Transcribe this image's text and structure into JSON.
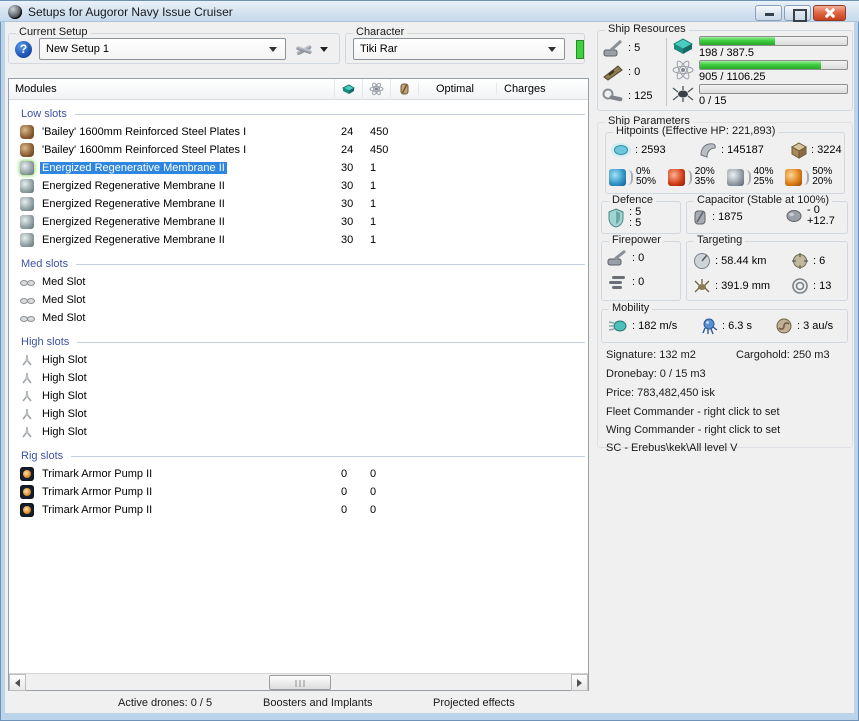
{
  "window": {
    "title": "Setups for Augoror Navy Issue Cruiser"
  },
  "icons": {
    "help": "?"
  },
  "colors": {
    "selection": "#2f86e0",
    "accent_green": "#3dd13d",
    "section_header_blue": "#3f51a0",
    "progress_green": "#3fcf3f",
    "em": "#2e90c2",
    "thermal": "#cf3a14",
    "kinetic": "#8e98a2",
    "explosive": "#d97a14",
    "close_button_red": "#c8401f"
  },
  "setup_bar": {
    "current_setup_label": "Current Setup",
    "current_setup_value": "New Setup 1",
    "character_label": "Character",
    "character_value": "Tiki Rar"
  },
  "modules_panel": {
    "title": "Modules",
    "optimal_label": "Optimal",
    "charges_label": "Charges",
    "sections": [
      {
        "title": "Low slots",
        "rows": [
          {
            "name": "'Bailey' 1600mm Reinforced Steel Plates I",
            "cpu": "24",
            "pg": "450"
          },
          {
            "name": "'Bailey' 1600mm Reinforced Steel Plates I",
            "cpu": "24",
            "pg": "450"
          },
          {
            "name": "Energized Regenerative Membrane II",
            "cpu": "30",
            "pg": "1"
          },
          {
            "name": "Energized Regenerative Membrane II",
            "cpu": "30",
            "pg": "1"
          },
          {
            "name": "Energized Regenerative Membrane II",
            "cpu": "30",
            "pg": "1"
          },
          {
            "name": "Energized Regenerative Membrane II",
            "cpu": "30",
            "pg": "1"
          },
          {
            "name": "Energized Regenerative Membrane II",
            "cpu": "30",
            "pg": "1"
          }
        ]
      },
      {
        "title": "Med slots",
        "rows": [
          {
            "name": "Med Slot",
            "cpu": "",
            "pg": ""
          },
          {
            "name": "Med Slot",
            "cpu": "",
            "pg": ""
          },
          {
            "name": "Med Slot",
            "cpu": "",
            "pg": ""
          }
        ]
      },
      {
        "title": "High slots",
        "rows": [
          {
            "name": "High Slot",
            "cpu": "",
            "pg": ""
          },
          {
            "name": "High Slot",
            "cpu": "",
            "pg": ""
          },
          {
            "name": "High Slot",
            "cpu": "",
            "pg": ""
          },
          {
            "name": "High Slot",
            "cpu": "",
            "pg": ""
          },
          {
            "name": "High Slot",
            "cpu": "",
            "pg": ""
          }
        ]
      },
      {
        "title": "Rig slots",
        "rows": [
          {
            "name": "Trimark Armor Pump II",
            "cpu": "0",
            "pg": "0"
          },
          {
            "name": "Trimark Armor Pump II",
            "cpu": "0",
            "pg": "0"
          },
          {
            "name": "Trimark Armor Pump II",
            "cpu": "0",
            "pg": "0"
          }
        ]
      }
    ]
  },
  "bottom_bar": {
    "active_drones": "Active drones: 0 / 5",
    "boosters_and_implants": "Boosters and Implants",
    "projected_effects": "Projected effects"
  },
  "ship_resources": {
    "title": "Ship Resources",
    "turret_slots": ": 5",
    "launcher_slots": ": 0",
    "calibration": ": 125",
    "cpu": {
      "text": "198 / 387.5",
      "pct": 51
    },
    "powergrid": {
      "text": "905 / 1106.25",
      "pct": 82
    },
    "dronebay": {
      "text": "0 / 15",
      "pct": 0
    }
  },
  "ship_parameters": {
    "title": "Ship Parameters",
    "hitpoints": {
      "title": "Hitpoints (Effective HP: 221,893)",
      "shield": ": 2593",
      "armor": ": 145187",
      "structure": ": 3224",
      "resists": [
        {
          "name": "em",
          "line1": "0%",
          "line2": "50%"
        },
        {
          "name": "thermal",
          "line1": "20%",
          "line2": "35%"
        },
        {
          "name": "kinetic",
          "line1": "40%",
          "line2": "25%"
        },
        {
          "name": "explosive",
          "line1": "50%",
          "line2": "20%"
        }
      ]
    },
    "defence": {
      "title": "Defence",
      "value_top": ": 5",
      "value_bottom": ": 5"
    },
    "capacitor": {
      "title": "Capacitor (Stable at 100%)",
      "amount": ": 1875",
      "delta_top": "- 0",
      "delta_bottom": "+12.7"
    },
    "firepower": {
      "title": "Firepower",
      "turret_dps": ": 0",
      "missile_dps": ": 0"
    },
    "targeting": {
      "title": "Targeting",
      "range": ": 58.44 km",
      "max_targets": ": 6",
      "scan_resolution": ": 391.9 mm",
      "sensor_strength": ": 13"
    },
    "mobility": {
      "title": "Mobility",
      "max_velocity": ": 182 m/s",
      "align_time": ": 6.3 s",
      "warp_speed": ": 3 au/s"
    },
    "info": {
      "signature": "Signature: 132 m2",
      "cargohold": "Cargohold: 250 m3",
      "dronebay": "Dronebay: 0 / 15 m3",
      "price": "Price: 783,482,450 isk",
      "fleet_commander": "Fleet Commander - right click to set",
      "wing_commander": "Wing Commander - right click to set",
      "sc": "SC - Erebus\\kek\\All level V"
    }
  }
}
